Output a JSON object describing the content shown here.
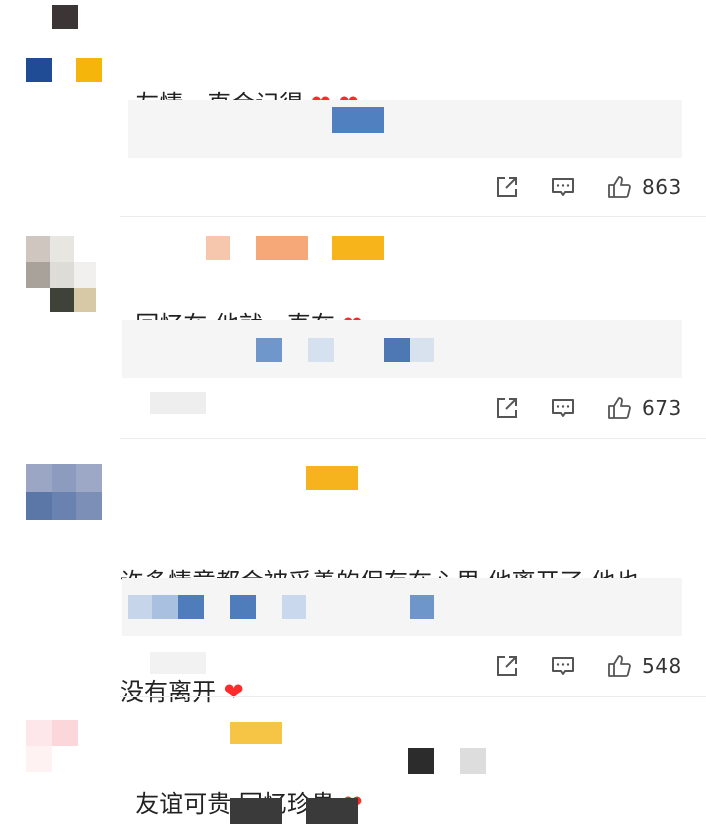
{
  "colors": {
    "heart": "#ff2b2b",
    "reply_bg": "#f5f5f5",
    "mosaic_blue": "#4d7ab7",
    "mosaic_orange": "#f7a724"
  },
  "comments": [
    {
      "text": "友情一直会记得",
      "hearts": "❤ ❤",
      "likes": "863"
    },
    {
      "text": "回忆在 他就一直在",
      "hearts": "❤",
      "likes": "673"
    },
    {
      "text_line1": "许多情意都会被妥善的保存在心里 他离开了 他也",
      "text_line2": "没有离开",
      "hearts": "❤",
      "likes": "548"
    },
    {
      "text": "友谊可贵 回忆珍贵",
      "hearts": "❤"
    }
  ],
  "icons": {
    "share": "share-icon",
    "comment": "comment-icon",
    "like": "thumbs-up-icon"
  }
}
